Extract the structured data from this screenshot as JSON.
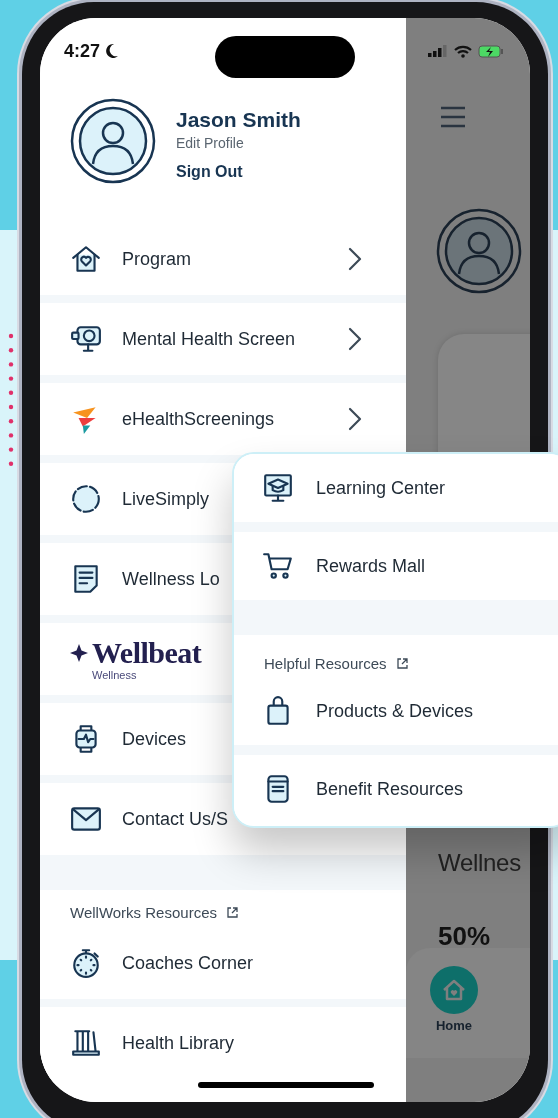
{
  "status_bar": {
    "time": "4:27"
  },
  "profile": {
    "name": "Jason Smith",
    "edit_link": "Edit Profile",
    "sign_out": "Sign Out"
  },
  "menu_items": [
    {
      "kind": "link",
      "label": "Program",
      "chevron": true
    },
    {
      "kind": "link",
      "label": "Mental Health Screen",
      "chevron": true
    },
    {
      "kind": "link",
      "label": "eHealthScreenings",
      "chevron": true
    },
    {
      "kind": "link",
      "label": "LiveSimply"
    },
    {
      "kind": "link",
      "label": "Wellness Lo"
    },
    {
      "kind": "logo",
      "label": "Wellbeat",
      "sublabel": "Wellness"
    },
    {
      "kind": "link",
      "label": "Devices"
    },
    {
      "kind": "link",
      "label": "Contact Us/S"
    }
  ],
  "resources_section": {
    "title": "WellWorks Resources",
    "items": [
      {
        "label": "Coaches Corner"
      },
      {
        "label": "Health Library"
      }
    ]
  },
  "popup_menu": {
    "items": [
      {
        "label": "Learning Center"
      },
      {
        "label": "Rewards Mall"
      }
    ],
    "section": {
      "title": "Helpful Resources",
      "items": [
        {
          "label": "Products & Devices"
        },
        {
          "label": "Benefit Resources"
        }
      ]
    }
  },
  "background_screen": {
    "heading": "Wellnes",
    "percent": "50%",
    "nav": [
      {
        "label": "Home",
        "selected": true
      }
    ]
  }
}
